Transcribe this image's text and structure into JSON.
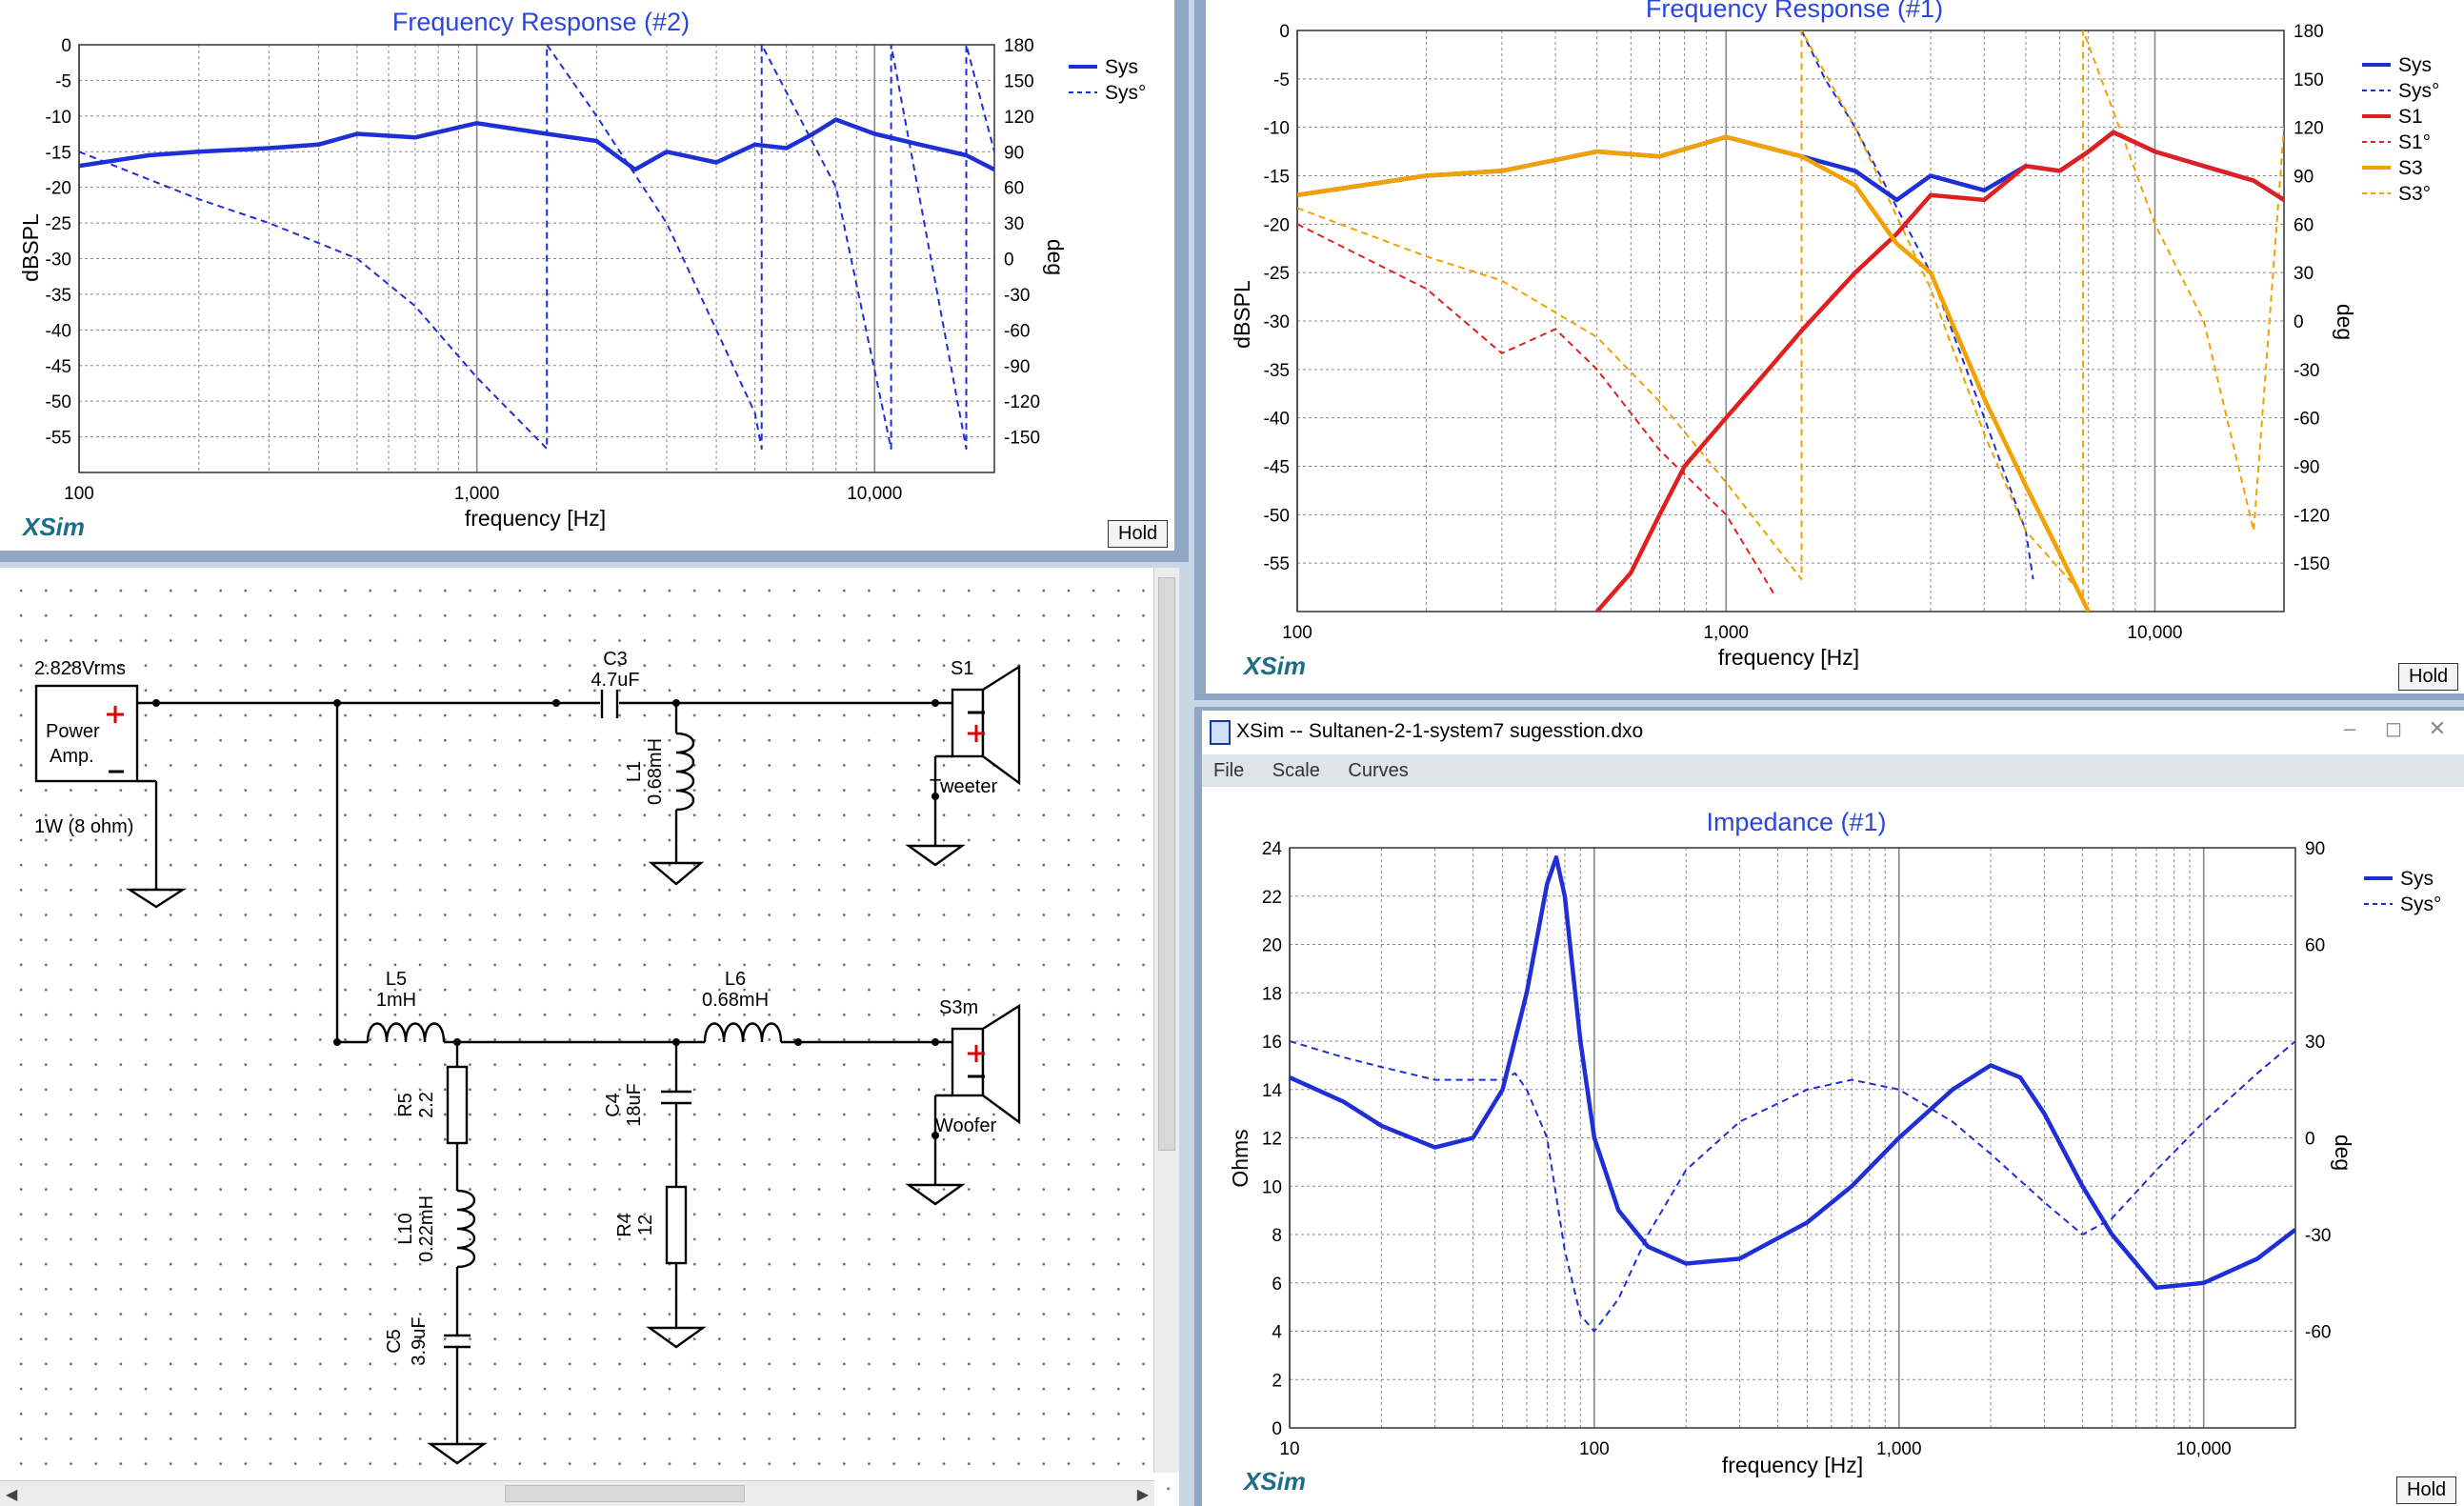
{
  "fr2": {
    "title": "Frequency Response (#2)",
    "ylabel": "dBSPL",
    "y2label": "deg",
    "xlabel": "frequency [Hz]",
    "y_ticks": [
      "0",
      "-5",
      "-10",
      "-15",
      "-20",
      "-25",
      "-30",
      "-35",
      "-40",
      "-45",
      "-50",
      "-55"
    ],
    "y2_ticks": [
      "180",
      "150",
      "120",
      "90",
      "60",
      "30",
      "0",
      "-30",
      "-60",
      "-90",
      "-120",
      "-150"
    ],
    "x_ticks": [
      "100",
      "1,000",
      "10,000"
    ],
    "legend": [
      "Sys",
      "Sys°"
    ],
    "brand": "XSim",
    "hold": "Hold"
  },
  "fr1": {
    "title": "Frequency Response (#1)",
    "ylabel": "dBSPL",
    "y2label": "deg",
    "xlabel": "frequency [Hz]",
    "y_ticks": [
      "0",
      "-5",
      "-10",
      "-15",
      "-20",
      "-25",
      "-30",
      "-35",
      "-40",
      "-45",
      "-50",
      "-55"
    ],
    "y2_ticks": [
      "180",
      "150",
      "120",
      "90",
      "60",
      "30",
      "0",
      "-30",
      "-60",
      "-90",
      "-120",
      "-150"
    ],
    "x_ticks": [
      "100",
      "1,000",
      "10,000"
    ],
    "legend": [
      "Sys",
      "Sys°",
      "S1",
      "S1°",
      "S3",
      "S3°"
    ],
    "brand": "XSim",
    "hold": "Hold"
  },
  "imp": {
    "window_title": "XSim -- Sultanen-2-1-system7 sugesstion.dxo",
    "menu": [
      "File",
      "Scale",
      "Curves"
    ],
    "title": "Impedance (#1)",
    "ylabel": "Ohms",
    "y2label": "deg",
    "xlabel": "frequency [Hz]",
    "y_ticks": [
      "24",
      "22",
      "20",
      "18",
      "16",
      "14",
      "12",
      "10",
      "8",
      "6",
      "4",
      "2",
      "0"
    ],
    "y2_ticks": [
      "90",
      "60",
      "30",
      "0",
      "-30",
      "-60"
    ],
    "x_ticks": [
      "10",
      "100",
      "1,000",
      "10,000"
    ],
    "legend": [
      "Sys",
      "Sys°"
    ],
    "brand": "XSim",
    "hold": "Hold"
  },
  "schematic": {
    "source_voltage": "2.828Vrms",
    "source_label1": "Power",
    "source_label2": "Amp.",
    "source_power": "1W (8 ohm)",
    "c3_name": "C3",
    "c3_value": "4.7uF",
    "l1_name": "L1",
    "l1_value": "0.68mH",
    "s1_name": "S1",
    "s1_label": "Tweeter",
    "l5_name": "L5",
    "l5_value": "1mH",
    "l6_name": "L6",
    "l6_value": "0.68mH",
    "s3_name": "S3m",
    "s3_label": "Woofer",
    "r5_name": "R5",
    "r5_value": "2.2",
    "c4_name": "C4",
    "c4_value": "18uF",
    "l10_name": "L10",
    "l10_value": "0.22mH",
    "r4_name": "R4",
    "r4_value": "12",
    "c5_name": "C5",
    "c5_value": "3.9uF"
  },
  "colors": {
    "blue": "#1f2fd6",
    "red": "#e02020",
    "orange": "#f2a100",
    "grid": "#777"
  },
  "chart_data": [
    {
      "type": "line",
      "title": "Frequency Response (#2)",
      "xlabel": "frequency [Hz]",
      "ylabel": "dBSPL",
      "y2label": "deg",
      "xscale": "log",
      "xlim": [
        100,
        20000
      ],
      "ylim": [
        -60,
        0
      ],
      "y2lim": [
        -180,
        180
      ],
      "series": [
        {
          "name": "Sys",
          "axis": "y",
          "x": [
            100,
            150,
            200,
            300,
            400,
            500,
            700,
            1000,
            1500,
            2000,
            2500,
            3000,
            4000,
            5000,
            6000,
            7000,
            8000,
            10000,
            13000,
            17000,
            20000
          ],
          "y": [
            -17,
            -15.5,
            -15,
            -14.5,
            -14,
            -12.5,
            -13,
            -11,
            -12.5,
            -13.5,
            -17.5,
            -15,
            -16.5,
            -14,
            -14.5,
            -12.5,
            -10.5,
            -12.5,
            -14,
            -15.5,
            -17.5
          ]
        },
        {
          "name": "Sys°",
          "axis": "y2",
          "x": [
            100,
            200,
            300,
            500,
            700,
            1000,
            1500,
            1500,
            2000,
            3000,
            4000,
            5000,
            5200,
            5200,
            8000,
            11000,
            11000,
            17000,
            17000,
            20000
          ],
          "y": [
            90,
            50,
            30,
            0,
            -40,
            -100,
            -160,
            180,
            120,
            30,
            -60,
            -130,
            -160,
            180,
            60,
            -160,
            180,
            -160,
            180,
            90
          ]
        }
      ]
    },
    {
      "type": "line",
      "title": "Frequency Response (#1)",
      "xlabel": "frequency [Hz]",
      "ylabel": "dBSPL",
      "y2label": "deg",
      "xscale": "log",
      "xlim": [
        100,
        20000
      ],
      "ylim": [
        -60,
        0
      ],
      "y2lim": [
        -180,
        180
      ],
      "series": [
        {
          "name": "Sys",
          "axis": "y",
          "x": [
            100,
            200,
            300,
            500,
            700,
            1000,
            1500,
            2000,
            2500,
            3000,
            4000,
            5000,
            6000,
            7000,
            8000,
            10000,
            13000,
            17000,
            20000
          ],
          "y": [
            -17,
            -15,
            -14.5,
            -12.5,
            -13,
            -11,
            -13,
            -14.5,
            -17.5,
            -15,
            -16.5,
            -14,
            -14.5,
            -12.5,
            -10.5,
            -12.5,
            -14,
            -15.5,
            -17.5
          ]
        },
        {
          "name": "Sys°",
          "axis": "y2",
          "x": [
            1500,
            1700,
            2000,
            3000,
            4000,
            5000,
            5200
          ],
          "y": [
            180,
            150,
            120,
            30,
            -60,
            -130,
            -160
          ]
        },
        {
          "name": "S1",
          "axis": "y",
          "x": [
            500,
            600,
            700,
            800,
            1000,
            1200,
            1500,
            2000,
            2500,
            3000,
            4000,
            5000,
            6000,
            7000,
            8000,
            10000,
            13000,
            17000,
            20000
          ],
          "y": [
            -60,
            -56,
            -50,
            -45,
            -40,
            -36,
            -31,
            -25,
            -21,
            -17,
            -17.5,
            -14,
            -14.5,
            -12.5,
            -10.5,
            -12.5,
            -14,
            -15.5,
            -17.5
          ]
        },
        {
          "name": "S1°",
          "axis": "y2",
          "x": [
            100,
            200,
            300,
            400,
            500,
            700,
            1000,
            1300
          ],
          "y": [
            60,
            20,
            -20,
            -5,
            -30,
            -80,
            -120,
            -170
          ]
        },
        {
          "name": "S3",
          "axis": "y",
          "x": [
            100,
            200,
            300,
            500,
            700,
            1000,
            1500,
            2000,
            2500,
            3000,
            4000,
            5000,
            6000,
            7000
          ],
          "y": [
            -17,
            -15,
            -14.5,
            -12.5,
            -13,
            -11,
            -13,
            -16,
            -22,
            -25,
            -38,
            -47,
            -54,
            -60
          ]
        },
        {
          "name": "S3°",
          "axis": "y2",
          "x": [
            100,
            200,
            300,
            500,
            700,
            1000,
            1500,
            1500,
            2000,
            3000,
            4000,
            5000,
            6800,
            6800,
            8000,
            10000,
            13000,
            17000,
            20000
          ],
          "y": [
            70,
            40,
            25,
            -10,
            -50,
            -100,
            -160,
            180,
            120,
            20,
            -70,
            -130,
            -170,
            180,
            130,
            60,
            0,
            -130,
            120
          ]
        }
      ]
    },
    {
      "type": "line",
      "title": "Impedance (#1)",
      "xlabel": "frequency [Hz]",
      "ylabel": "Ohms",
      "y2label": "deg",
      "xscale": "log",
      "xlim": [
        10,
        20000
      ],
      "ylim": [
        0,
        24
      ],
      "y2lim": [
        -90,
        90
      ],
      "series": [
        {
          "name": "Sys",
          "axis": "y",
          "x": [
            10,
            15,
            20,
            30,
            40,
            50,
            60,
            70,
            75,
            80,
            90,
            100,
            120,
            150,
            200,
            300,
            500,
            700,
            1000,
            1500,
            2000,
            2500,
            3000,
            4000,
            5000,
            7000,
            10000,
            15000,
            20000
          ],
          "y": [
            14.5,
            13.5,
            12.5,
            11.6,
            12,
            14,
            18,
            22.5,
            23.6,
            22,
            16,
            12,
            9,
            7.5,
            6.8,
            7,
            8.5,
            10,
            12,
            14,
            15,
            14.5,
            13,
            10,
            8,
            5.8,
            6,
            7,
            8.2
          ]
        },
        {
          "name": "Sys°",
          "axis": "y2",
          "x": [
            10,
            15,
            20,
            30,
            40,
            50,
            55,
            60,
            70,
            80,
            90,
            100,
            120,
            150,
            200,
            300,
            500,
            700,
            1000,
            1500,
            2000,
            3000,
            4000,
            5000,
            7000,
            10000,
            15000,
            20000
          ],
          "y": [
            30,
            25,
            22,
            18,
            18,
            18,
            20,
            15,
            0,
            -35,
            -55,
            -60,
            -50,
            -30,
            -10,
            5,
            15,
            18,
            15,
            5,
            -5,
            -20,
            -30,
            -25,
            -10,
            5,
            20,
            30
          ]
        }
      ]
    }
  ]
}
